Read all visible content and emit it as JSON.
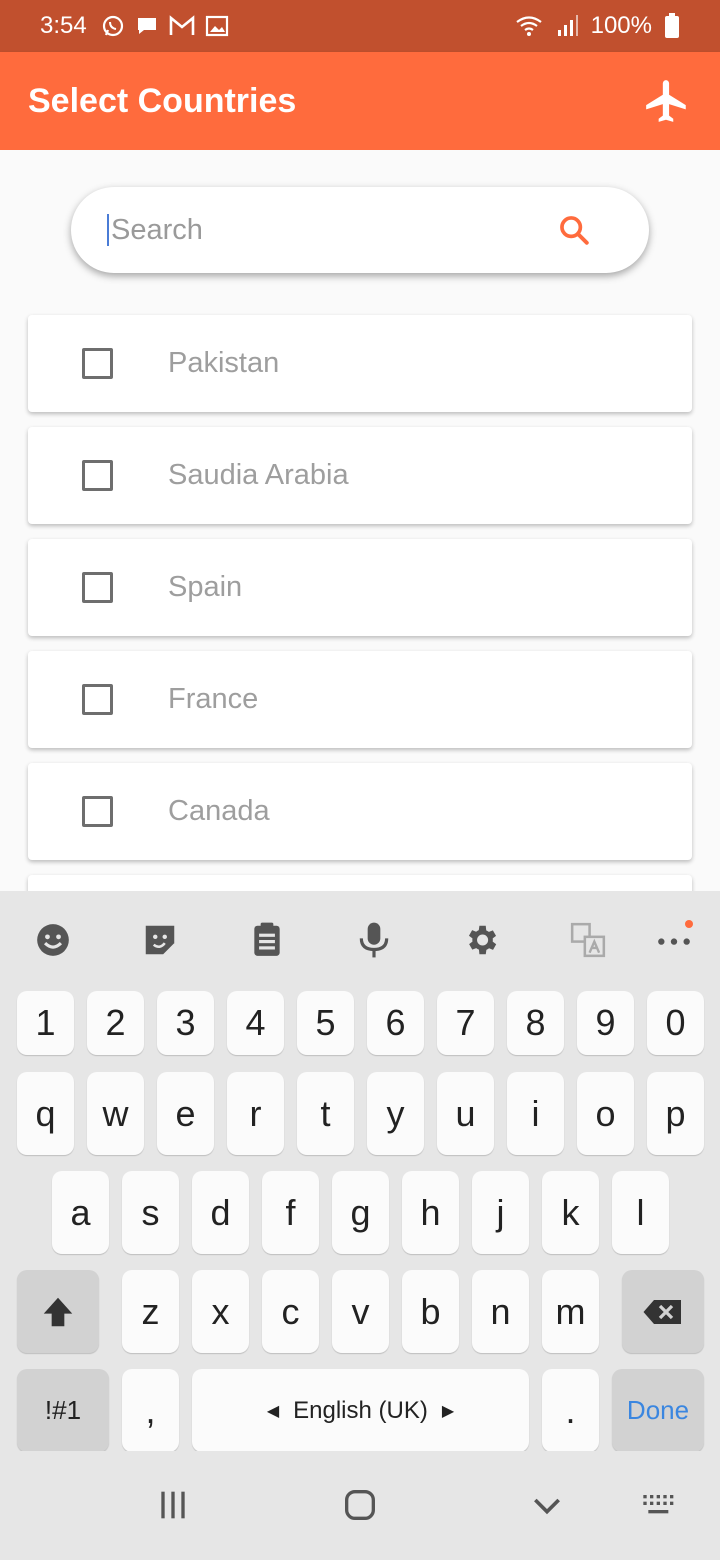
{
  "status_bar": {
    "time": "3:54",
    "battery": "100%",
    "icons": [
      "whatsapp-icon",
      "message-icon",
      "gmail-icon",
      "gallery-icon",
      "wifi-icon",
      "signal-icon",
      "battery-icon"
    ]
  },
  "app_bar": {
    "title": "Select Countries",
    "action_icon": "airplane-icon",
    "color": "#ff6b3d"
  },
  "search": {
    "placeholder": "Search",
    "value": "",
    "icon": "search-icon"
  },
  "countries": [
    {
      "label": "Pakistan",
      "checked": false
    },
    {
      "label": "Saudia Arabia",
      "checked": false
    },
    {
      "label": "Spain",
      "checked": false
    },
    {
      "label": "France",
      "checked": false
    },
    {
      "label": "Canada",
      "checked": false
    }
  ],
  "keyboard": {
    "toolbar": [
      "emoji-icon",
      "sticker-icon",
      "clipboard-icon",
      "microphone-icon",
      "settings-icon",
      "translate-icon",
      "more-icon"
    ],
    "row_numbers": [
      "1",
      "2",
      "3",
      "4",
      "5",
      "6",
      "7",
      "8",
      "9",
      "0"
    ],
    "row_1": [
      "q",
      "w",
      "e",
      "r",
      "t",
      "y",
      "u",
      "i",
      "o",
      "p"
    ],
    "row_2": [
      "a",
      "s",
      "d",
      "f",
      "g",
      "h",
      "j",
      "k",
      "l"
    ],
    "row_3": [
      "z",
      "x",
      "c",
      "v",
      "b",
      "n",
      "m"
    ],
    "symbols_label": "!#1",
    "comma": ",",
    "space_label": "English (UK)",
    "period": ".",
    "done_label": "Done"
  },
  "nav_bar": [
    "recents-icon",
    "home-icon",
    "back-icon",
    "keyboard-icon"
  ]
}
